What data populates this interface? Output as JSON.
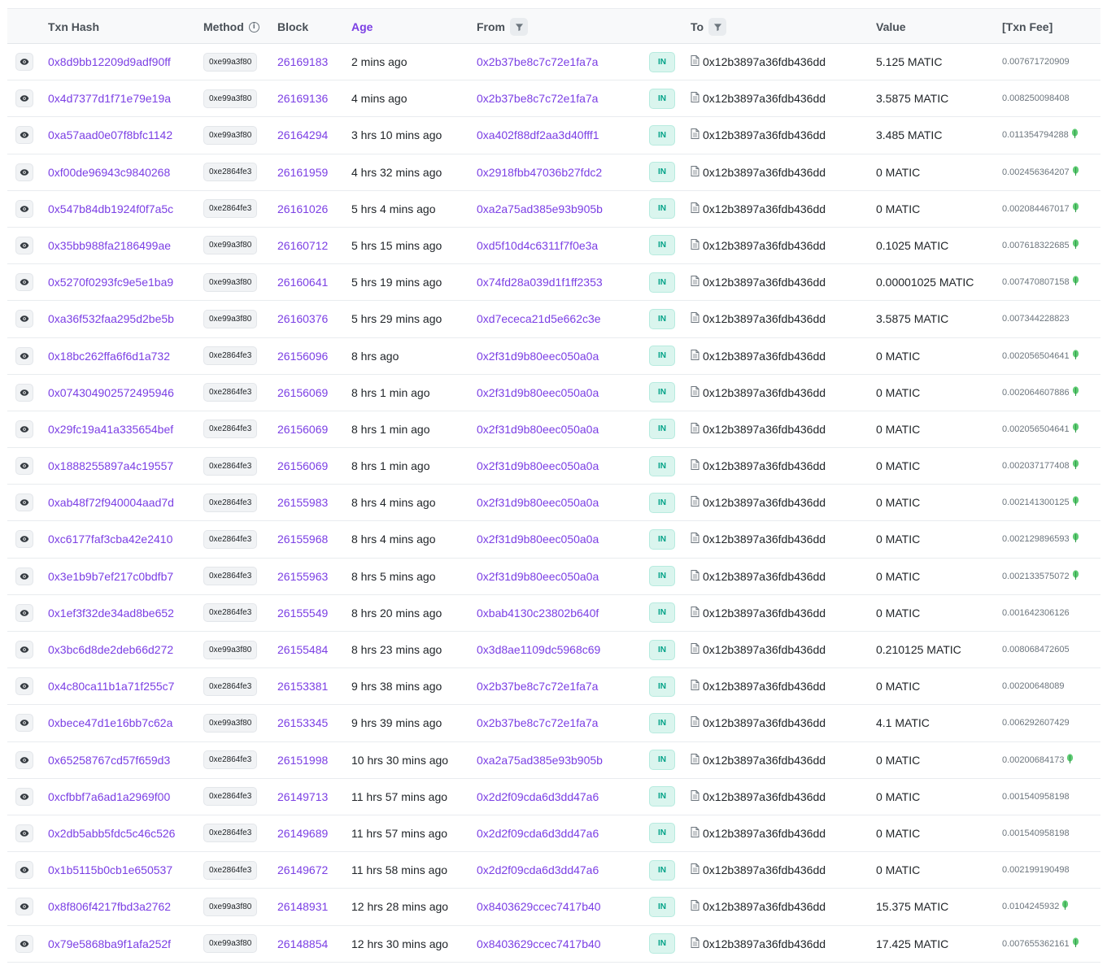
{
  "header": {
    "txn_hash": "Txn Hash",
    "method": "Method",
    "block": "Block",
    "age": "Age",
    "from": "From",
    "to": "To",
    "value": "Value",
    "txn_fee": "[Txn Fee]"
  },
  "colors": {
    "link": "#7b3fe4",
    "in_badge_bg": "#daf5ee",
    "in_badge_text": "#00a186",
    "leaf_green": "#5ecb73"
  },
  "icons": {
    "view": "eye-icon",
    "info": "info-circle-icon",
    "filter": "filter-icon",
    "contract": "document-icon",
    "fee_tip": "leaf-icon"
  },
  "rows": [
    {
      "hash": "0x8d9bb12209d9adf90ff",
      "method": "0xe99a3f80",
      "block": "26169183",
      "age": "2 mins ago",
      "from": "0x2b37be8c7c72e1fa7a",
      "dir": "IN",
      "to": "0x12b3897a36fdb436dd",
      "value": "5.125 MATIC",
      "fee": "0.007671720909",
      "leaf": false
    },
    {
      "hash": "0x4d7377d1f71e79e19a",
      "method": "0xe99a3f80",
      "block": "26169136",
      "age": "4 mins ago",
      "from": "0x2b37be8c7c72e1fa7a",
      "dir": "IN",
      "to": "0x12b3897a36fdb436dd",
      "value": "3.5875 MATIC",
      "fee": "0.008250098408",
      "leaf": false
    },
    {
      "hash": "0xa57aad0e07f8bfc1142",
      "method": "0xe99a3f80",
      "block": "26164294",
      "age": "3 hrs 10 mins ago",
      "from": "0xa402f88df2aa3d40fff1",
      "dir": "IN",
      "to": "0x12b3897a36fdb436dd",
      "value": "3.485 MATIC",
      "fee": "0.011354794288",
      "leaf": true
    },
    {
      "hash": "0xf00de96943c9840268",
      "method": "0xe2864fe3",
      "block": "26161959",
      "age": "4 hrs 32 mins ago",
      "from": "0x2918fbb47036b27fdc2",
      "dir": "IN",
      "to": "0x12b3897a36fdb436dd",
      "value": "0 MATIC",
      "fee": "0.002456364207",
      "leaf": true
    },
    {
      "hash": "0x547b84db1924f0f7a5c",
      "method": "0xe2864fe3",
      "block": "26161026",
      "age": "5 hrs 4 mins ago",
      "from": "0xa2a75ad385e93b905b",
      "dir": "IN",
      "to": "0x12b3897a36fdb436dd",
      "value": "0 MATIC",
      "fee": "0.002084467017",
      "leaf": true
    },
    {
      "hash": "0x35bb988fa2186499ae",
      "method": "0xe99a3f80",
      "block": "26160712",
      "age": "5 hrs 15 mins ago",
      "from": "0xd5f10d4c6311f7f0e3a",
      "dir": "IN",
      "to": "0x12b3897a36fdb436dd",
      "value": "0.1025 MATIC",
      "fee": "0.007618322685",
      "leaf": true
    },
    {
      "hash": "0x5270f0293fc9e5e1ba9",
      "method": "0xe99a3f80",
      "block": "26160641",
      "age": "5 hrs 19 mins ago",
      "from": "0x74fd28a039d1f1ff2353",
      "dir": "IN",
      "to": "0x12b3897a36fdb436dd",
      "value": "0.00001025 MATIC",
      "fee": "0.007470807158",
      "leaf": true
    },
    {
      "hash": "0xa36f532faa295d2be5b",
      "method": "0xe99a3f80",
      "block": "26160376",
      "age": "5 hrs 29 mins ago",
      "from": "0xd7ececa21d5e662c3e",
      "dir": "IN",
      "to": "0x12b3897a36fdb436dd",
      "value": "3.5875 MATIC",
      "fee": "0.007344228823",
      "leaf": false
    },
    {
      "hash": "0x18bc262ffa6f6d1a732",
      "method": "0xe2864fe3",
      "block": "26156096",
      "age": "8 hrs ago",
      "from": "0x2f31d9b80eec050a0a",
      "dir": "IN",
      "to": "0x12b3897a36fdb436dd",
      "value": "0 MATIC",
      "fee": "0.002056504641",
      "leaf": true
    },
    {
      "hash": "0x074304902572495946",
      "method": "0xe2864fe3",
      "block": "26156069",
      "age": "8 hrs 1 min ago",
      "from": "0x2f31d9b80eec050a0a",
      "dir": "IN",
      "to": "0x12b3897a36fdb436dd",
      "value": "0 MATIC",
      "fee": "0.002064607886",
      "leaf": true
    },
    {
      "hash": "0x29fc19a41a335654bef",
      "method": "0xe2864fe3",
      "block": "26156069",
      "age": "8 hrs 1 min ago",
      "from": "0x2f31d9b80eec050a0a",
      "dir": "IN",
      "to": "0x12b3897a36fdb436dd",
      "value": "0 MATIC",
      "fee": "0.002056504641",
      "leaf": true
    },
    {
      "hash": "0x1888255897a4c19557",
      "method": "0xe2864fe3",
      "block": "26156069",
      "age": "8 hrs 1 min ago",
      "from": "0x2f31d9b80eec050a0a",
      "dir": "IN",
      "to": "0x12b3897a36fdb436dd",
      "value": "0 MATIC",
      "fee": "0.002037177408",
      "leaf": true
    },
    {
      "hash": "0xab48f72f940004aad7d",
      "method": "0xe2864fe3",
      "block": "26155983",
      "age": "8 hrs 4 mins ago",
      "from": "0x2f31d9b80eec050a0a",
      "dir": "IN",
      "to": "0x12b3897a36fdb436dd",
      "value": "0 MATIC",
      "fee": "0.002141300125",
      "leaf": true
    },
    {
      "hash": "0xc6177faf3cba42e2410",
      "method": "0xe2864fe3",
      "block": "26155968",
      "age": "8 hrs 4 mins ago",
      "from": "0x2f31d9b80eec050a0a",
      "dir": "IN",
      "to": "0x12b3897a36fdb436dd",
      "value": "0 MATIC",
      "fee": "0.002129896593",
      "leaf": true
    },
    {
      "hash": "0x3e1b9b7ef217c0bdfb7",
      "method": "0xe2864fe3",
      "block": "26155963",
      "age": "8 hrs 5 mins ago",
      "from": "0x2f31d9b80eec050a0a",
      "dir": "IN",
      "to": "0x12b3897a36fdb436dd",
      "value": "0 MATIC",
      "fee": "0.002133575072",
      "leaf": true
    },
    {
      "hash": "0x1ef3f32de34ad8be652",
      "method": "0xe2864fe3",
      "block": "26155549",
      "age": "8 hrs 20 mins ago",
      "from": "0xbab4130c23802b640f",
      "dir": "IN",
      "to": "0x12b3897a36fdb436dd",
      "value": "0 MATIC",
      "fee": "0.001642306126",
      "leaf": false
    },
    {
      "hash": "0x3bc6d8de2deb66d272",
      "method": "0xe99a3f80",
      "block": "26155484",
      "age": "8 hrs 23 mins ago",
      "from": "0x3d8ae1109dc5968c69",
      "dir": "IN",
      "to": "0x12b3897a36fdb436dd",
      "value": "0.210125 MATIC",
      "fee": "0.008068472605",
      "leaf": false
    },
    {
      "hash": "0x4c80ca11b1a71f255c7",
      "method": "0xe2864fe3",
      "block": "26153381",
      "age": "9 hrs 38 mins ago",
      "from": "0x2b37be8c7c72e1fa7a",
      "dir": "IN",
      "to": "0x12b3897a36fdb436dd",
      "value": "0 MATIC",
      "fee": "0.00200648089",
      "leaf": false
    },
    {
      "hash": "0xbece47d1e16bb7c62a",
      "method": "0xe99a3f80",
      "block": "26153345",
      "age": "9 hrs 39 mins ago",
      "from": "0x2b37be8c7c72e1fa7a",
      "dir": "IN",
      "to": "0x12b3897a36fdb436dd",
      "value": "4.1 MATIC",
      "fee": "0.006292607429",
      "leaf": false
    },
    {
      "hash": "0x65258767cd57f659d3",
      "method": "0xe2864fe3",
      "block": "26151998",
      "age": "10 hrs 30 mins ago",
      "from": "0xa2a75ad385e93b905b",
      "dir": "IN",
      "to": "0x12b3897a36fdb436dd",
      "value": "0 MATIC",
      "fee": "0.00200684173",
      "leaf": true
    },
    {
      "hash": "0xcfbbf7a6ad1a2969f00",
      "method": "0xe2864fe3",
      "block": "26149713",
      "age": "11 hrs 57 mins ago",
      "from": "0x2d2f09cda6d3dd47a6",
      "dir": "IN",
      "to": "0x12b3897a36fdb436dd",
      "value": "0 MATIC",
      "fee": "0.001540958198",
      "leaf": false
    },
    {
      "hash": "0x2db5abb5fdc5c46c526",
      "method": "0xe2864fe3",
      "block": "26149689",
      "age": "11 hrs 57 mins ago",
      "from": "0x2d2f09cda6d3dd47a6",
      "dir": "IN",
      "to": "0x12b3897a36fdb436dd",
      "value": "0 MATIC",
      "fee": "0.001540958198",
      "leaf": false
    },
    {
      "hash": "0x1b5115b0cb1e650537",
      "method": "0xe2864fe3",
      "block": "26149672",
      "age": "11 hrs 58 mins ago",
      "from": "0x2d2f09cda6d3dd47a6",
      "dir": "IN",
      "to": "0x12b3897a36fdb436dd",
      "value": "0 MATIC",
      "fee": "0.002199190498",
      "leaf": false
    },
    {
      "hash": "0x8f806f4217fbd3a2762",
      "method": "0xe99a3f80",
      "block": "26148931",
      "age": "12 hrs 28 mins ago",
      "from": "0x8403629ccec7417b40",
      "dir": "IN",
      "to": "0x12b3897a36fdb436dd",
      "value": "15.375 MATIC",
      "fee": "0.0104245932",
      "leaf": true
    },
    {
      "hash": "0x79e5868ba9f1afa252f",
      "method": "0xe99a3f80",
      "block": "26148854",
      "age": "12 hrs 30 mins ago",
      "from": "0x8403629ccec7417b40",
      "dir": "IN",
      "to": "0x12b3897a36fdb436dd",
      "value": "17.425 MATIC",
      "fee": "0.007655362161",
      "leaf": true
    }
  ]
}
